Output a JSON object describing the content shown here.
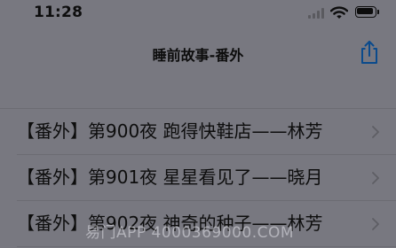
{
  "status_bar": {
    "time": "11:28",
    "signal_icon": "signal-icon",
    "wifi_icon": "wifi-icon",
    "battery_icon": "battery-icon",
    "battery_level": 0.85
  },
  "nav_bar": {
    "title": "睡前故事-番外",
    "share_icon": "share-icon",
    "accent_color": "#0a4a8c"
  },
  "list": {
    "chevron_icon": "chevron-right-icon",
    "items": [
      {
        "label": "【番外】第900夜 跑得快鞋店——林芳"
      },
      {
        "label": "【番外】第901夜 星星看见了——晓月"
      },
      {
        "label": "【番外】第902夜 神奇的种子——林芳"
      }
    ]
  },
  "watermark": {
    "text": "易门APP 4000369000.COM"
  }
}
